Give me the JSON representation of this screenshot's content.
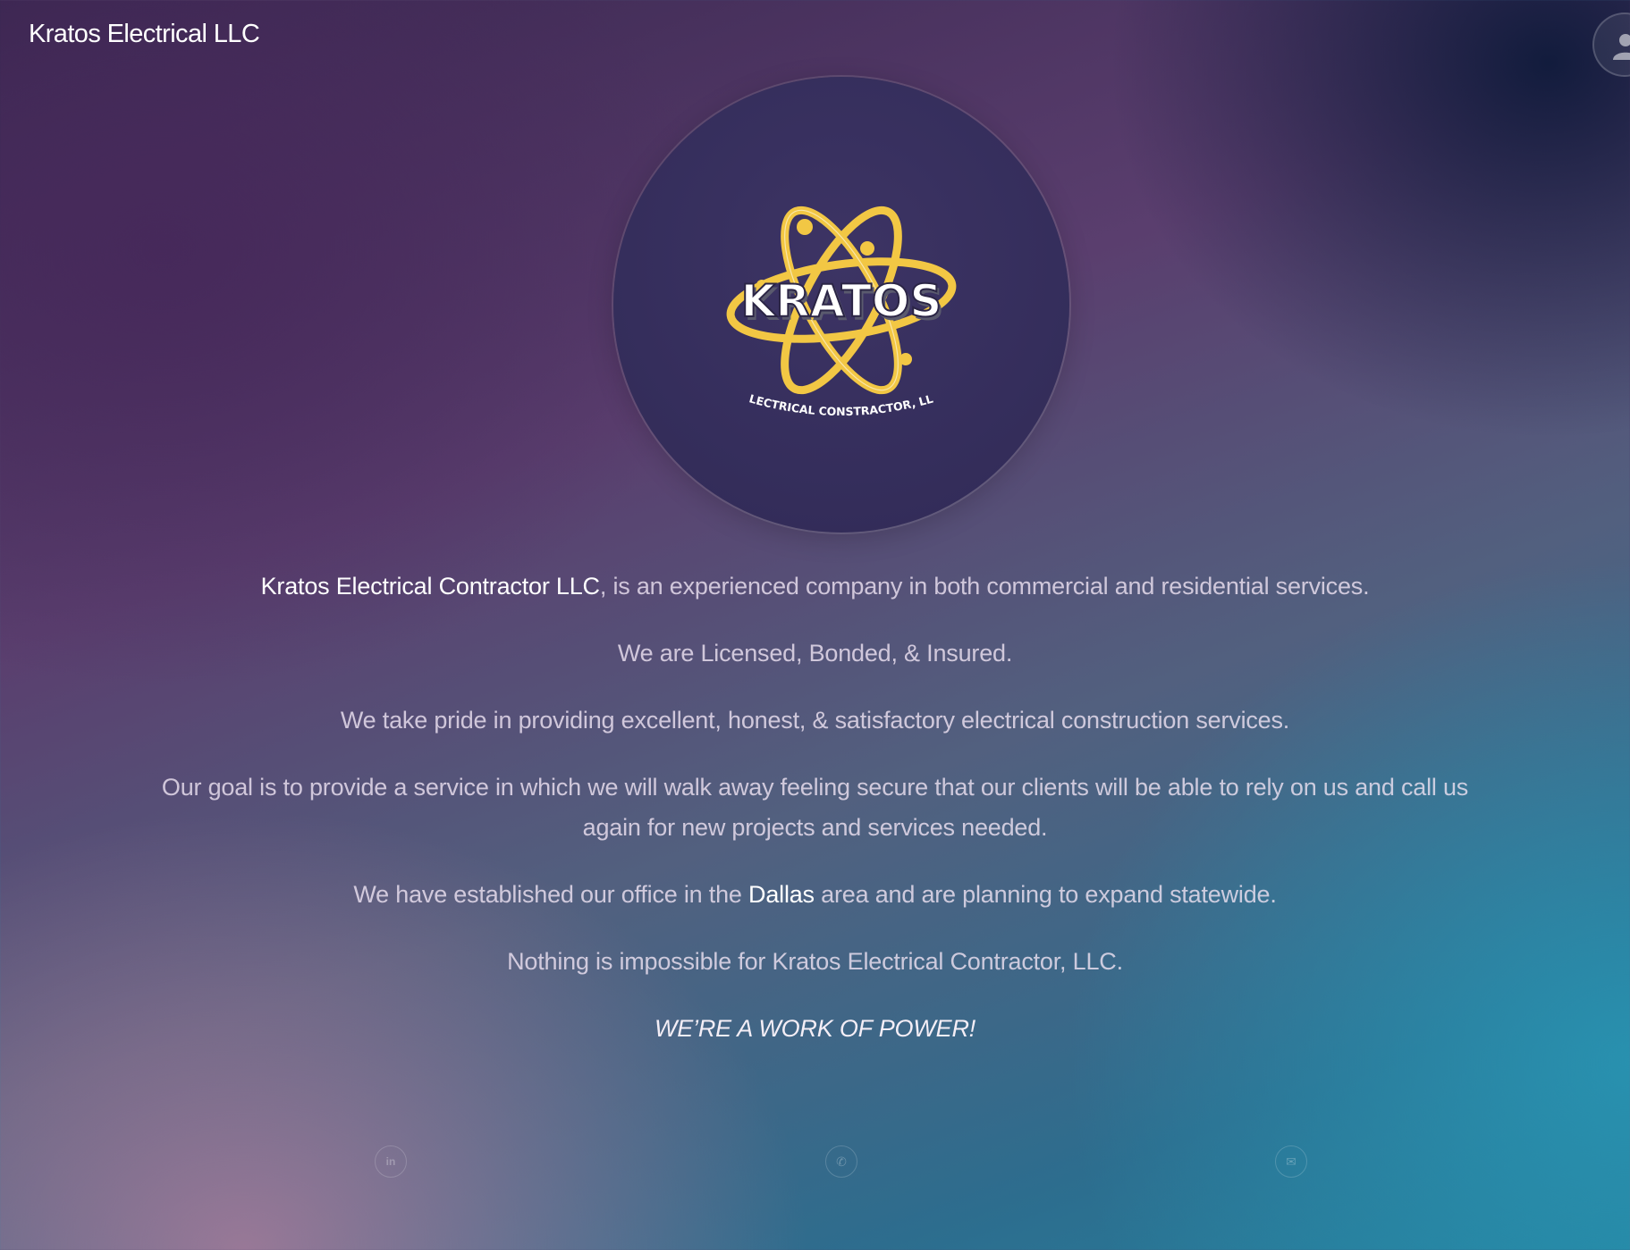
{
  "header": {
    "brand": "Kratos Electrical LLC",
    "user_icon": "user-icon"
  },
  "logo": {
    "wordmark": "KRATOS",
    "tagline": "ELECTRICAL CONSTRACTOR, LLC",
    "colors": {
      "circle": "#352e5c",
      "atom": "#f2c744",
      "text": "#ffffff"
    }
  },
  "about": {
    "intro_bold": "Kratos Electrical Contractor LLC",
    "intro_rest": ", is an experienced company in both commercial and residential services.",
    "licensed": "We are Licensed, Bonded, & Insured.",
    "pride": "We take pride in providing excellent, honest, & satisfactory electrical construction services.",
    "goal": "Our goal is to provide a service in which we will walk away feeling secure that our clients will be able to rely on us and call us again for new projects and services needed.",
    "office_before": "We have established our office in the ",
    "office_city": "Dallas",
    "office_after": " area and are planning to expand statewide.",
    "impossible": "Nothing is impossible for Kratos Electrical Contractor, LLC.",
    "slogan": "WE’RE A WORK OF POWER!"
  },
  "social": [
    {
      "icon": "linkedin-icon",
      "glyph": "in"
    },
    {
      "icon": "phone-icon",
      "glyph": "✆"
    },
    {
      "icon": "envelope-icon",
      "glyph": "✉"
    }
  ]
}
